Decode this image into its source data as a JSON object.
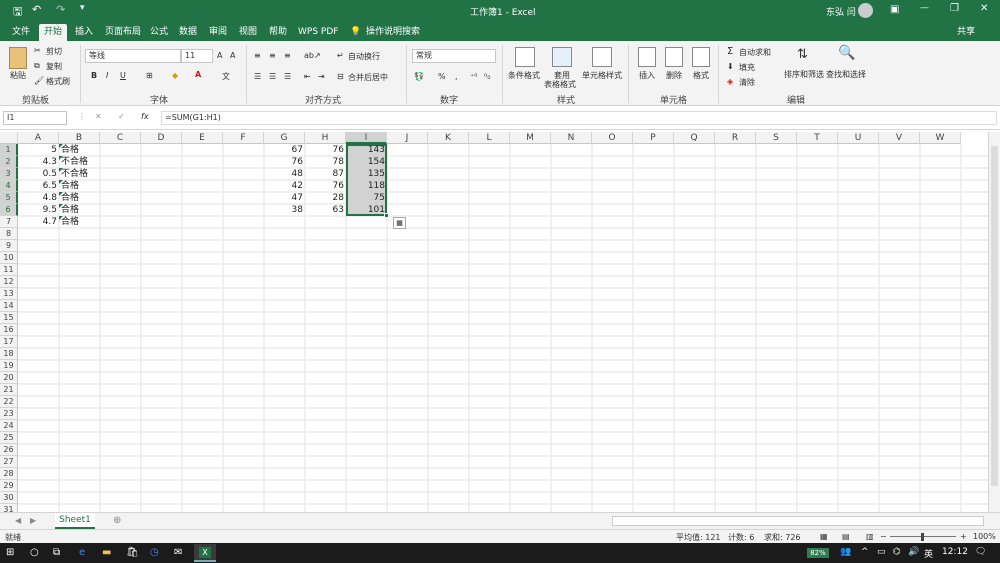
{
  "titlebar": {
    "title": "工作簿1  -  Excel",
    "user": "东弘 闫"
  },
  "tabs": [
    "文件",
    "开始",
    "插入",
    "页面布局",
    "公式",
    "数据",
    "审阅",
    "视图",
    "帮助",
    "WPS PDF"
  ],
  "tell_me": "操作说明搜索",
  "share": "共享",
  "ribbon": {
    "clipboard": {
      "paste": "粘贴",
      "cut": "剪切",
      "copy": "复制",
      "format_painter": "格式刷",
      "label": "剪贴板"
    },
    "font": {
      "name": "等线",
      "size": "11",
      "bold": "B",
      "italic": "I",
      "underline": "U",
      "label": "字体"
    },
    "alignment": {
      "wrap": "自动换行",
      "merge": "合并后居中",
      "label": "对齐方式"
    },
    "number": {
      "format": "常规",
      "percent": "%",
      "comma": ",",
      "label": "数字"
    },
    "styles": {
      "conditional": "条件格式",
      "table_top": "套用",
      "table_bottom": "表格格式",
      "cell_styles": "单元格样式",
      "label": "样式"
    },
    "cells": {
      "insert": "插入",
      "delete": "删除",
      "format": "格式",
      "label": "单元格"
    },
    "editing": {
      "autosum": "自动求和",
      "fill": "填充",
      "clear": "清除",
      "sort": "排序和筛选",
      "find": "查找和选择",
      "label": "编辑"
    }
  },
  "formula_bar": {
    "name_box": "I1",
    "formula": "=SUM(G1:H1)",
    "fx": "fx"
  },
  "columns": [
    "A",
    "B",
    "C",
    "D",
    "E",
    "F",
    "G",
    "H",
    "I",
    "J",
    "K",
    "L",
    "M",
    "N",
    "O",
    "P",
    "Q",
    "R",
    "S",
    "T",
    "U",
    "V",
    "W"
  ],
  "rows": [
    "1",
    "2",
    "3",
    "4",
    "5",
    "6",
    "7",
    "8",
    "9",
    "10",
    "11",
    "12",
    "13",
    "14",
    "15",
    "16",
    "17",
    "18",
    "19",
    "20",
    "21",
    "22",
    "23",
    "24",
    "25",
    "26",
    "27",
    "28",
    "29",
    "30",
    "31"
  ],
  "cells": {
    "A": [
      "5",
      "4.3",
      "0.5",
      "6.5",
      "4.8",
      "9.5",
      "4.7"
    ],
    "B": [
      "合格",
      "不合格",
      "不合格",
      "合格",
      "合格",
      "合格",
      "合格"
    ],
    "G": [
      "67",
      "76",
      "48",
      "42",
      "47",
      "38"
    ],
    "H": [
      "76",
      "78",
      "87",
      "76",
      "28",
      "63"
    ],
    "I": [
      "143",
      "154",
      "135",
      "118",
      "75",
      "101"
    ]
  },
  "sheet_tab": "Sheet1",
  "status": {
    "ready": "就绪",
    "average": "平均值: 121",
    "count": "计数: 6",
    "sum": "求和: 726",
    "zoom": "100%"
  },
  "taskbar": {
    "battery": "82%",
    "ime": "英",
    "time": "12:12"
  },
  "colors": {
    "accent": "#217346",
    "selection": "#d2d2d2"
  }
}
